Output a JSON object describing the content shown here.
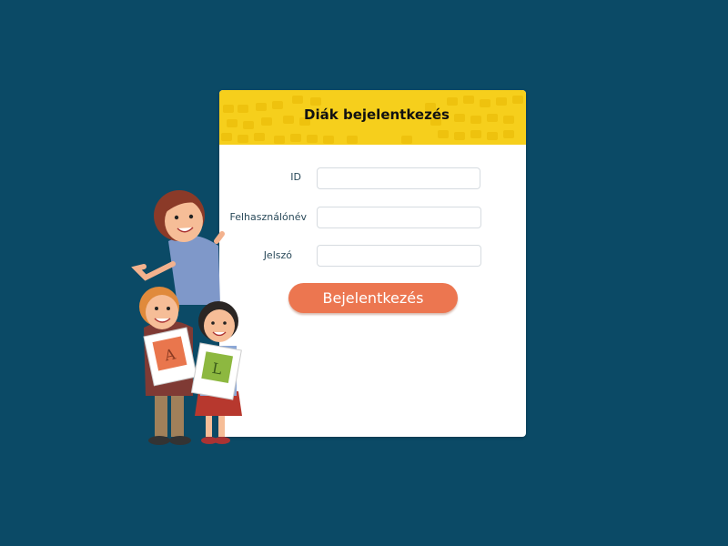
{
  "login_card": {
    "title": "Diák bejelentkezés",
    "fields": {
      "id_label": "ID",
      "username_label": "Felhasználónév",
      "password_label": "Jelszó"
    },
    "submit_label": "Bejelentkezés"
  },
  "illustration": {
    "card_left_letter": "A",
    "card_right_letter": "L"
  },
  "colors": {
    "background": "#0b4a66",
    "header_yellow": "#f6cf1c",
    "button_orange": "#ec7650"
  }
}
